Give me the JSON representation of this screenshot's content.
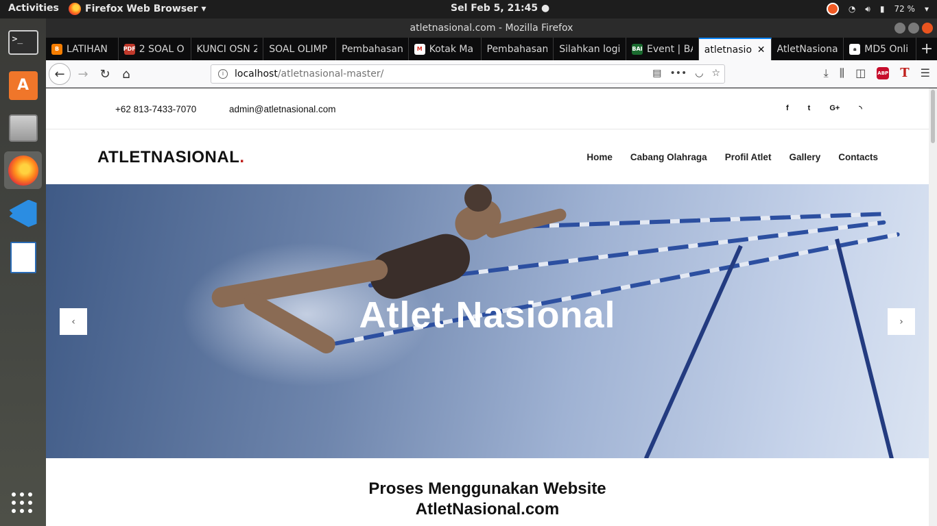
{
  "system": {
    "activities": "Activities",
    "app_menu": "Firefox Web Browser ▾",
    "clock": "Sel Feb  5, 21:45 ●",
    "battery": "72 %"
  },
  "window": {
    "title": "atletnasional.com - Mozilla Firefox"
  },
  "tabs": [
    {
      "label": "LATIHAN",
      "favicon": "blogger-icon"
    },
    {
      "label": "2 SOAL O",
      "favicon": "pdf-icon"
    },
    {
      "label": "KUNCI OSN 2",
      "favicon": ""
    },
    {
      "label": "SOAL OLIMP",
      "favicon": ""
    },
    {
      "label": "Pembahasan",
      "favicon": ""
    },
    {
      "label": "Kotak Ma",
      "favicon": "gmail-icon"
    },
    {
      "label": "Pembahasan",
      "favicon": ""
    },
    {
      "label": "Silahkan logi",
      "favicon": ""
    },
    {
      "label": "Event | BA",
      "favicon": "bai-icon"
    },
    {
      "label": "atletnasio",
      "favicon": "",
      "active": true
    },
    {
      "label": "AtletNasiona",
      "favicon": ""
    },
    {
      "label": "MD5 Onli",
      "favicon": "lock-icon"
    }
  ],
  "urlbar": {
    "host": "localhost",
    "path": "/atletnasional-master/"
  },
  "site": {
    "phone": "+62 813-7433-7070",
    "email": "admin@atletnasional.com",
    "socials": [
      "f",
      "t",
      "G+",
      "rss"
    ],
    "brand": "ATLETNASIONAL",
    "brand_dot": ".",
    "menu": [
      "Home",
      "Cabang Olahraga",
      "Profil Atlet",
      "Gallery",
      "Contacts"
    ],
    "hero_title": "Atlet Nasional",
    "prev": "‹",
    "next": "›",
    "section_title_line1": "Proses Menggunakan Website",
    "section_title_line2": "AtletNasional.com"
  },
  "colors": {
    "accent": "#c0201d",
    "tab_highlight": "#0a84ff"
  }
}
